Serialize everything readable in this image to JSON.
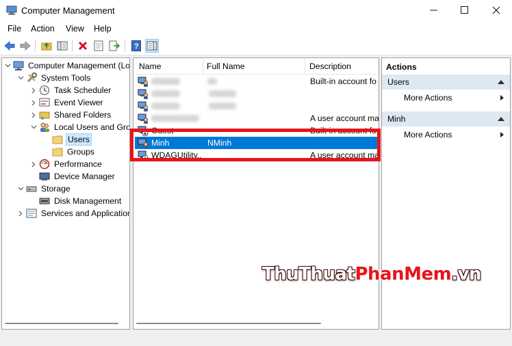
{
  "window": {
    "title": "Computer Management"
  },
  "menu": [
    "File",
    "Action",
    "View",
    "Help"
  ],
  "tree": {
    "items": [
      {
        "label": "Computer Management (Local",
        "icon": "computer-icon",
        "expander": "expanded"
      },
      {
        "label": "System Tools",
        "icon": "tools-icon",
        "expander": "expanded"
      },
      {
        "label": "Task Scheduler",
        "icon": "clock-icon",
        "expander": "collapsed"
      },
      {
        "label": "Event Viewer",
        "icon": "event-viewer-icon",
        "expander": "collapsed"
      },
      {
        "label": "Shared Folders",
        "icon": "shared-folder-icon",
        "expander": "collapsed"
      },
      {
        "label": "Local Users and Groups",
        "icon": "users-groups-icon",
        "expander": "expanded"
      },
      {
        "label": "Users",
        "icon": "folder-icon",
        "expander": "none",
        "selected": true
      },
      {
        "label": "Groups",
        "icon": "folder-icon",
        "expander": "none"
      },
      {
        "label": "Performance",
        "icon": "performance-icon",
        "expander": "collapsed"
      },
      {
        "label": "Device Manager",
        "icon": "device-manager-icon",
        "expander": "none"
      },
      {
        "label": "Storage",
        "icon": "storage-icon",
        "expander": "expanded"
      },
      {
        "label": "Disk Management",
        "icon": "disk-icon",
        "expander": "none"
      },
      {
        "label": "Services and Applications",
        "icon": "services-icon",
        "expander": "collapsed"
      }
    ]
  },
  "list": {
    "columns": [
      "Name",
      "Full Name",
      "Description"
    ],
    "rows": [
      {
        "name": "",
        "full_name": "",
        "description": "Built-in account fo"
      },
      {
        "name": "",
        "full_name": "",
        "description": ""
      },
      {
        "name": "",
        "full_name": "",
        "description": ""
      },
      {
        "name": "",
        "full_name": "",
        "description": "A user account ma"
      },
      {
        "name": "Guest",
        "full_name": "",
        "description": "Built-in account fo"
      },
      {
        "name": "Minh",
        "full_name": "NMinh",
        "description": "",
        "selected": true
      },
      {
        "name": "WDAGUtility...",
        "full_name": "",
        "description": "A user account ma"
      }
    ]
  },
  "actions": {
    "header": "Actions",
    "sections": [
      {
        "title": "Users",
        "items": [
          "More Actions"
        ]
      },
      {
        "title": "Minh",
        "items": [
          "More Actions"
        ]
      }
    ]
  },
  "watermark": {
    "part1": "ThuThuat",
    "part2": "PhanMem",
    "part3": ".vn"
  },
  "colors": {
    "selection": "#0078d7",
    "highlight_box": "#e8131b",
    "section_bg": "#dde8f3"
  }
}
